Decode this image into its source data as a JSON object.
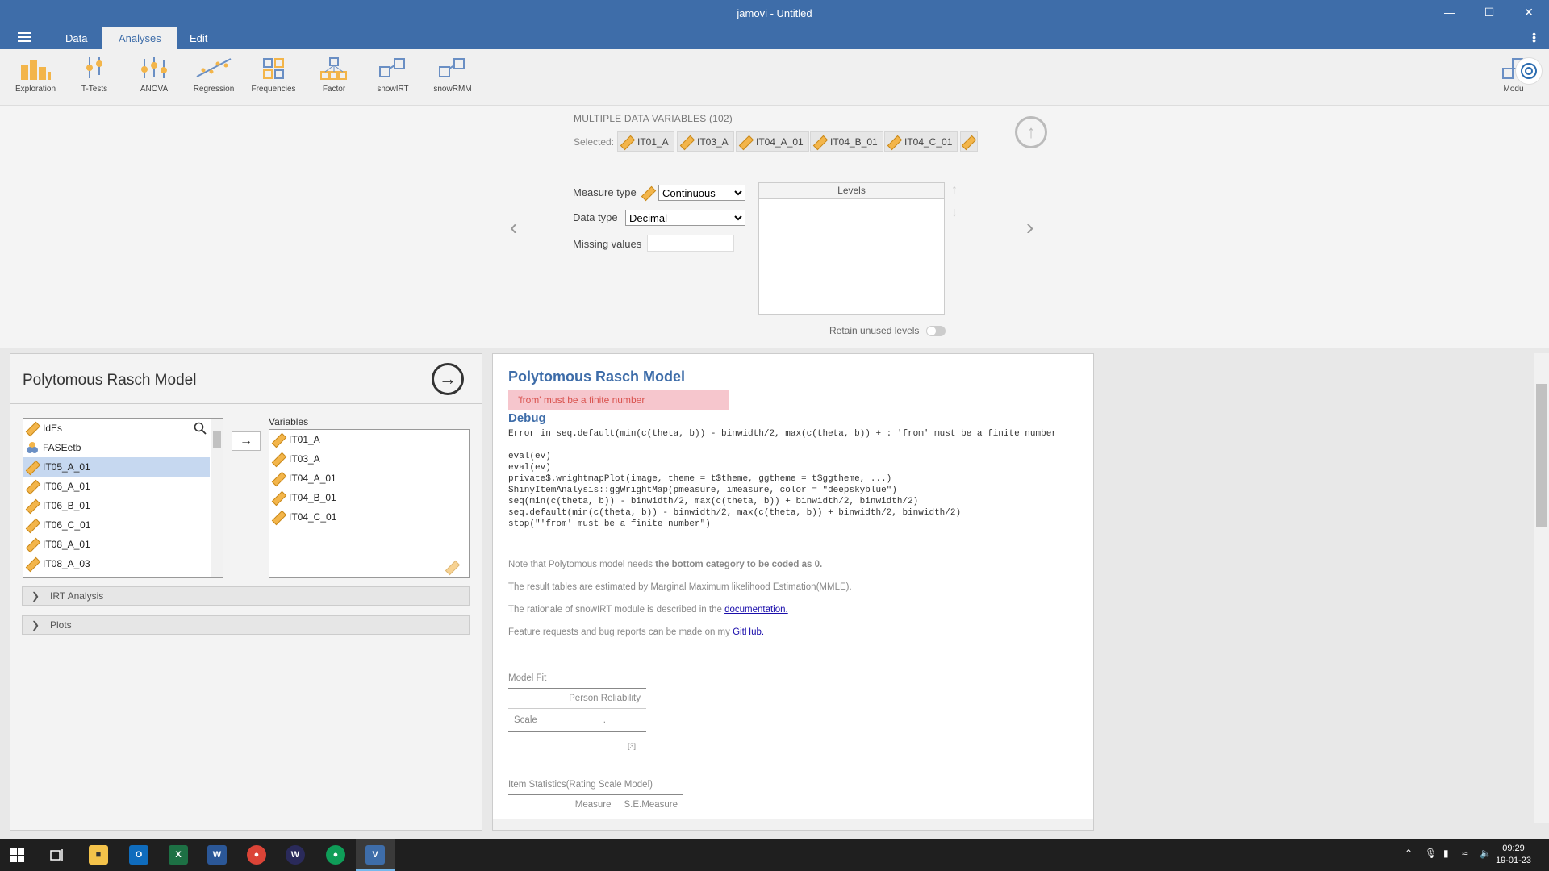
{
  "window": {
    "title": "jamovi - Untitled"
  },
  "menu": {
    "tabs": [
      "Data",
      "Analyses",
      "Edit"
    ],
    "active_tab": "Analyses"
  },
  "ribbon": {
    "buttons": [
      {
        "label": "Exploration",
        "icon": "exploration-icon"
      },
      {
        "label": "T-Tests",
        "icon": "t-tests-icon"
      },
      {
        "label": "ANOVA",
        "icon": "anova-icon"
      },
      {
        "label": "Regression",
        "icon": "regression-icon"
      },
      {
        "label": "Frequencies",
        "icon": "frequencies-icon"
      },
      {
        "label": "Factor",
        "icon": "factor-icon"
      },
      {
        "label": "snowIRT",
        "icon": "snowirt-icon"
      },
      {
        "label": "snowRMM",
        "icon": "snowrmm-icon"
      }
    ],
    "modules_label": "Modu"
  },
  "variable_setup": {
    "heading": "MULTIPLE DATA VARIABLES (102)",
    "selected_label": "Selected:",
    "selected_chips": [
      "IT01_A",
      "IT03_A",
      "IT04_A_01",
      "IT04_B_01",
      "IT04_C_01"
    ],
    "measure_type_label": "Measure type",
    "measure_type_value": "Continuous",
    "data_type_label": "Data type",
    "data_type_value": "Decimal",
    "missing_values_label": "Missing values",
    "missing_values_value": "",
    "levels_header": "Levels",
    "retain_label": "Retain unused levels",
    "retain_on": false
  },
  "options": {
    "title": "Polytomous Rasch Model",
    "source_list": [
      "IdEs",
      "FASEetb",
      "IT05_A_01",
      "IT06_A_01",
      "IT06_B_01",
      "IT06_C_01",
      "IT08_A_01",
      "IT08_A_03"
    ],
    "source_selected": "IT05_A_01",
    "variables_label": "Variables",
    "variables": [
      "IT01_A",
      "IT03_A",
      "IT04_A_01",
      "IT04_B_01",
      "IT04_C_01"
    ],
    "sections": [
      "IRT Analysis",
      "Plots"
    ]
  },
  "results": {
    "title": "Polytomous Rasch Model",
    "error": "'from' must be a finite number",
    "debug_title": "Debug",
    "debug_lines": [
      "Error in seq.default(min(c(theta, b)) - binwidth/2, max(c(theta, b)) + : 'from' must be a finite number",
      "",
      "eval(ev)",
      "eval(ev)",
      "private$.wrightmapPlot(image, theme = t$theme, ggtheme = t$ggtheme, ...)",
      "ShinyItemAnalysis::ggWrightMap(pmeasure, imeasure, color = \"deepskyblue\")",
      "seq(min(c(theta, b)) - binwidth/2, max(c(theta, b)) + binwidth/2, binwidth/2)",
      "seq.default(min(c(theta, b)) - binwidth/2, max(c(theta, b)) + binwidth/2, binwidth/2)",
      "stop(\"'from' must be a finite number\")"
    ],
    "note1_prefix": "Note that Polytomous model needs ",
    "note1_bold": "the bottom category to be coded as 0.",
    "note2": "The result tables are estimated by Marginal Maximum likelihood Estimation(MMLE).",
    "note3_prefix": "The rationale of snowIRT module is described in the ",
    "note3_link": "documentation.",
    "note4_prefix": "Feature requests and bug reports can be made on my ",
    "note4_link": "GitHub.",
    "model_fit": {
      "title": "Model Fit",
      "col": "Person Reliability",
      "row_label": "Scale",
      "row_value": ".",
      "footnote": "[3]"
    },
    "item_stats": {
      "title": "Item Statistics(Rating Scale Model)",
      "cols": [
        "Measure",
        "S.E.Measure"
      ]
    }
  },
  "taskbar": {
    "time": "09:29",
    "date": "19-01-23"
  }
}
